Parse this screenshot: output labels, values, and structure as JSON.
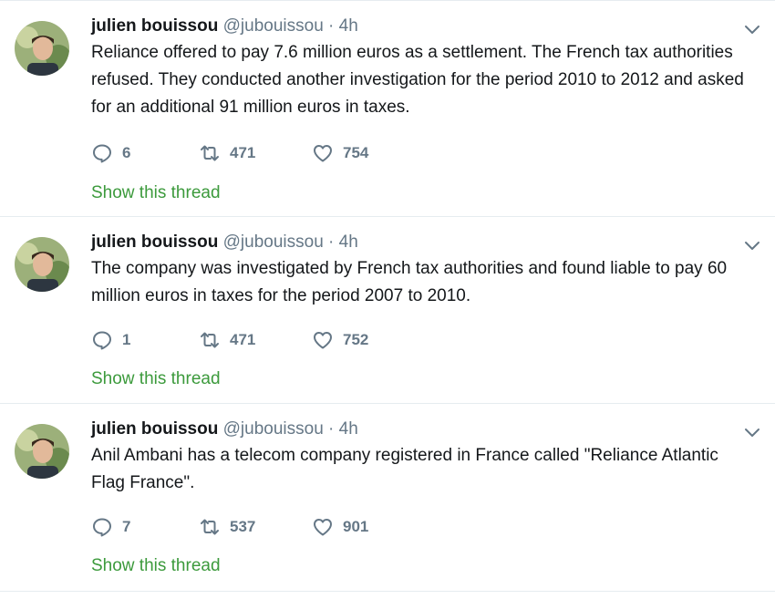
{
  "tweets": [
    {
      "name": "julien bouissou",
      "handle": "@jubouissou",
      "separator": "·",
      "time": "4h",
      "text": "Reliance offered to pay 7.6 million euros as a settlement. The French tax authorities refused. They conducted another investigation for the period 2010 to 2012 and asked for an additional 91 million euros in taxes.",
      "replies": "6",
      "retweets": "471",
      "likes": "754",
      "thread_link": "Show this thread"
    },
    {
      "name": "julien bouissou",
      "handle": "@jubouissou",
      "separator": "·",
      "time": "4h",
      "text": "The company was investigated by French tax authorities and found liable to pay 60 million euros in taxes for the period 2007 to 2010.",
      "replies": "1",
      "retweets": "471",
      "likes": "752",
      "thread_link": "Show this thread"
    },
    {
      "name": "julien bouissou",
      "handle": "@jubouissou",
      "separator": "·",
      "time": "4h",
      "text": "Anil Ambani has a telecom company registered in France called \"Reliance Atlantic Flag France\".",
      "replies": "7",
      "retweets": "537",
      "likes": "901",
      "thread_link": "Show this thread"
    }
  ],
  "icons": {
    "reply": "reply-icon",
    "retweet": "retweet-icon",
    "like": "heart-icon",
    "caret": "chevron-down-icon"
  },
  "colors": {
    "text": "#14171a",
    "muted": "#657786",
    "thread_link": "#3c9a3c",
    "divider": "#e6ecf0"
  }
}
